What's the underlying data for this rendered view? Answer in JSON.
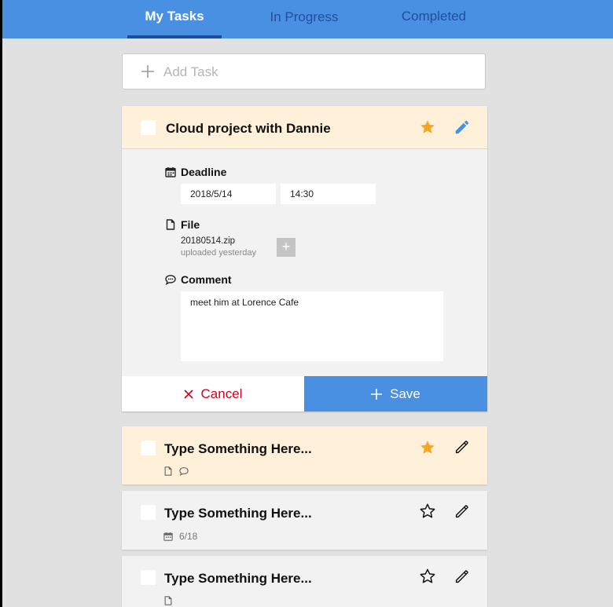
{
  "tabs": [
    {
      "label": "My Tasks",
      "active": true
    },
    {
      "label": "In Progress",
      "active": false
    },
    {
      "label": "Completed",
      "active": false
    }
  ],
  "add_task": {
    "placeholder": "Add Task"
  },
  "expanded_task": {
    "title": "Cloud project with Dannie",
    "starred": true,
    "deadline": {
      "label": "Deadline",
      "date": "2018/5/14",
      "time": "14:30"
    },
    "file": {
      "label": "File",
      "name": "20180514.zip",
      "uploaded": "uploaded yesterday",
      "add_symbol": "+"
    },
    "comment": {
      "label": "Comment",
      "text": "meet him at Lorence Cafe"
    },
    "actions": {
      "cancel": "Cancel",
      "save": "Save"
    }
  },
  "tasks": [
    {
      "title": "Type Something Here...",
      "starred": true,
      "meta": {
        "file": true,
        "comment": true,
        "date": ""
      }
    },
    {
      "title": "Type Something Here...",
      "starred": false,
      "meta": {
        "file": false,
        "comment": false,
        "date": "6/18"
      }
    },
    {
      "title": "Type Something Here...",
      "starred": false,
      "meta": {
        "file": true,
        "comment": false,
        "date": ""
      }
    }
  ],
  "colors": {
    "accent": "#4a90e2",
    "header_dark": "#1d4f97",
    "star": "#f5a623",
    "cancel": "#d0021b",
    "starred_bg": "#fff0d9",
    "background": "#e1e1e1"
  }
}
